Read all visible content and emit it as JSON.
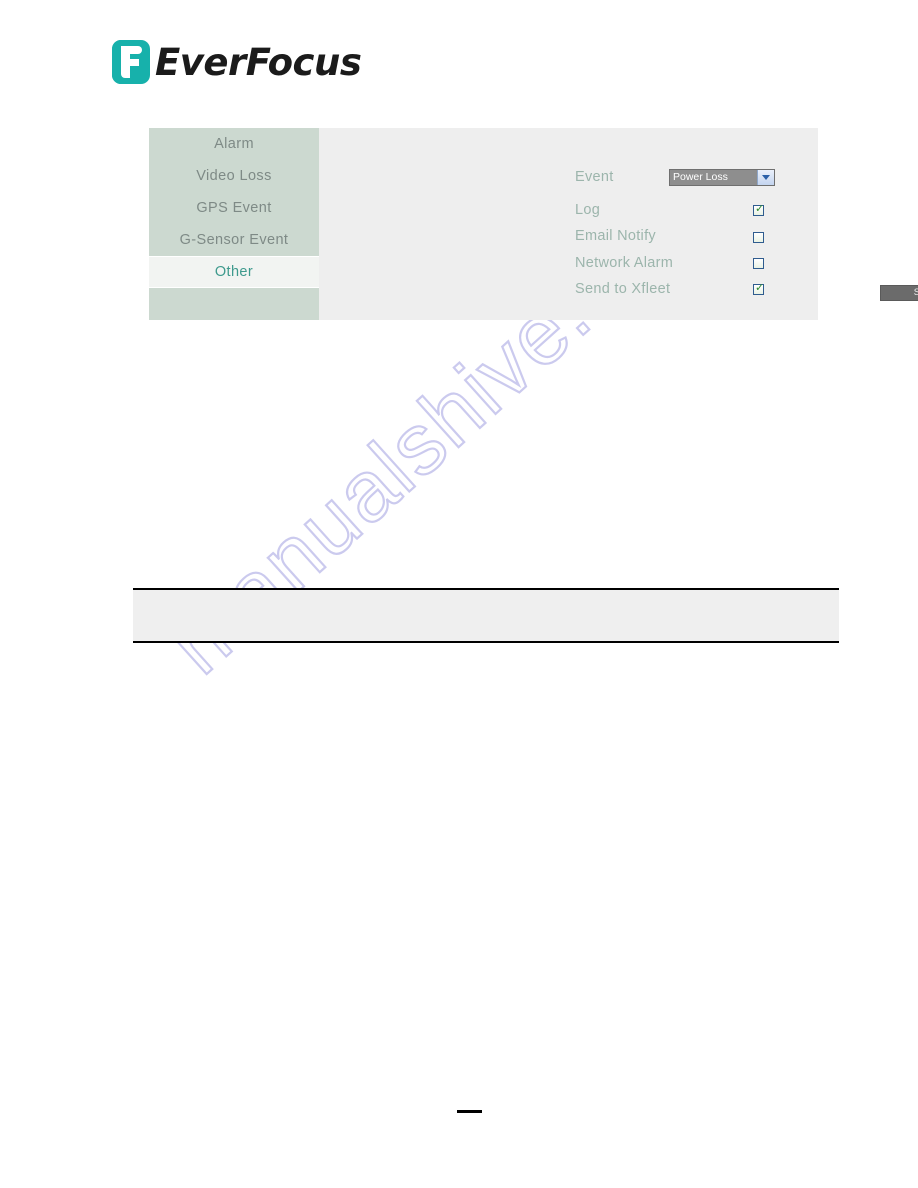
{
  "brand": {
    "logo_icon": "everfocus-f-logo-icon",
    "name": "EverFocus",
    "logo_color": "#17b1ab"
  },
  "watermark": {
    "text": "manualshive.com",
    "color": "#c9c8ee"
  },
  "panel": {
    "sidebar": {
      "items": [
        {
          "label": "Alarm",
          "selected": false
        },
        {
          "label": "Video Loss",
          "selected": false
        },
        {
          "label": "GPS Event",
          "selected": false
        },
        {
          "label": "G-Sensor Event",
          "selected": false
        },
        {
          "label": "Other",
          "selected": true
        }
      ],
      "background_color": "#ccd9d0",
      "selected_background_color": "#f2f4f2",
      "selected_text_color": "#3e9a8d",
      "text_color": "#7e8a86"
    },
    "form": {
      "event": {
        "label": "Event",
        "selected_value": "Power Loss",
        "options": [
          "Power Loss"
        ],
        "arrow_icon": "chevron-down-icon"
      },
      "checkboxes": [
        {
          "label": "Log",
          "checked": true,
          "mark": "✓"
        },
        {
          "label": "Email Notify",
          "checked": false,
          "mark": ""
        },
        {
          "label": "Network Alarm",
          "checked": false,
          "mark": ""
        },
        {
          "label": "Send to Xfleet",
          "checked": true,
          "mark": "✓"
        }
      ],
      "save_label": "Save",
      "label_color": "#9cb5ac"
    },
    "background_color": "#eeeeee"
  },
  "note_box": {
    "text": ""
  },
  "footer": {
    "rule": ""
  }
}
